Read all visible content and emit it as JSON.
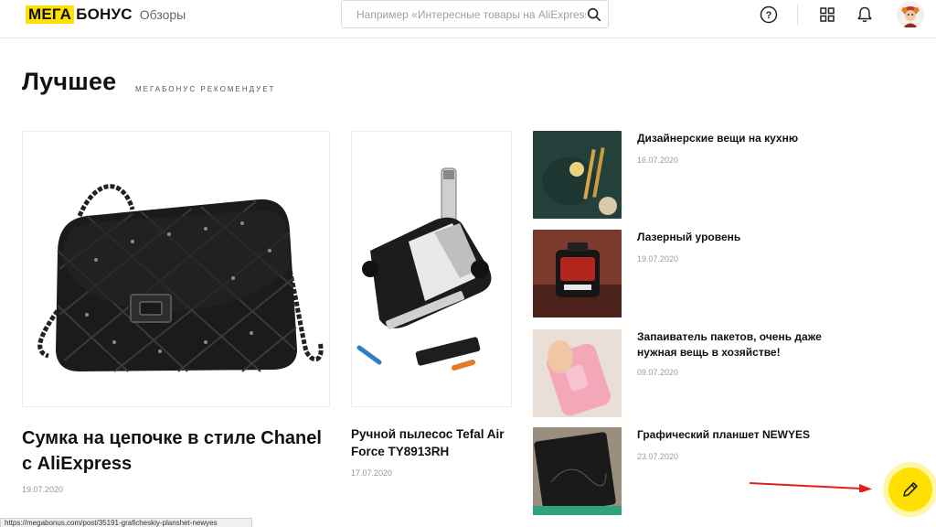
{
  "header": {
    "logo_mega": "МЕГА",
    "logo_bonus": "БОНУС",
    "logo_sub": "Обзоры",
    "search_placeholder": "Например «Интересные товары на AliExpress»",
    "icons": [
      "help-icon",
      "grid-icon",
      "bell-icon",
      "search-icon"
    ]
  },
  "section": {
    "title": "Лучшее",
    "subtitle": "мегабонус рекомендует"
  },
  "featured": [
    {
      "title": "Сумка на цепочке в стиле Chanel с AliExpress",
      "date": "19.07.2020"
    },
    {
      "title": "Ручной пылесос Tefal Air Force TY8913RH",
      "date": "17.07.2020"
    }
  ],
  "list": [
    {
      "title": "Дизайнерские вещи на кухню",
      "date": "16.07.2020"
    },
    {
      "title": "Лазерный уровень",
      "date": "19.07.2020"
    },
    {
      "title": "Запаиватель пакетов, очень даже нужная вещь в хозяйстве!",
      "date": "09.07.2020"
    },
    {
      "title": "Графический планшет NEWYES",
      "date": "23.07.2020"
    }
  ],
  "status_url": "https://megabonus.com/post/35191-graficheskiy-planshet-newyes",
  "colors": {
    "brand_yellow": "#ffe000",
    "arrow_red": "#e02020",
    "text": "#111111",
    "muted": "#999999"
  }
}
